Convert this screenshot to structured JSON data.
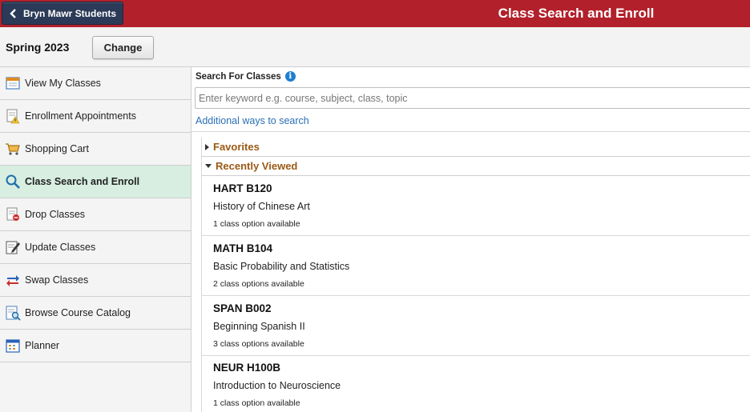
{
  "header": {
    "back_label": "Bryn Mawr Students",
    "title": "Class Search and Enroll",
    "bar_color": "#b2202b"
  },
  "term": {
    "label": "Spring 2023",
    "change_label": "Change"
  },
  "sidebar": {
    "items": [
      {
        "label": "View My Classes",
        "icon": "calendar-icon"
      },
      {
        "label": "Enrollment Appointments",
        "icon": "document-warning-icon"
      },
      {
        "label": "Shopping Cart",
        "icon": "cart-icon"
      },
      {
        "label": "Class Search and Enroll",
        "icon": "search-icon",
        "active": true
      },
      {
        "label": "Drop Classes",
        "icon": "drop-icon"
      },
      {
        "label": "Update Classes",
        "icon": "edit-icon"
      },
      {
        "label": "Swap Classes",
        "icon": "swap-icon"
      },
      {
        "label": "Browse Course Catalog",
        "icon": "catalog-icon"
      },
      {
        "label": "Planner",
        "icon": "planner-icon"
      }
    ]
  },
  "search": {
    "heading": "Search For Classes",
    "placeholder": "Enter keyword e.g. course, subject, class, topic",
    "more_link": "Additional ways to search"
  },
  "sections": {
    "favorites": "Favorites",
    "recent": "Recently Viewed"
  },
  "courses": [
    {
      "code": "HART B120",
      "title": "History of Chinese Art",
      "options": "1 class option available"
    },
    {
      "code": "MATH B104",
      "title": "Basic Probability and Statistics",
      "options": "2 class options available"
    },
    {
      "code": "SPAN B002",
      "title": "Beginning Spanish II",
      "options": "3 class options available"
    },
    {
      "code": "NEUR H100B",
      "title": "Introduction to Neuroscience",
      "options": "1 class option available"
    }
  ]
}
